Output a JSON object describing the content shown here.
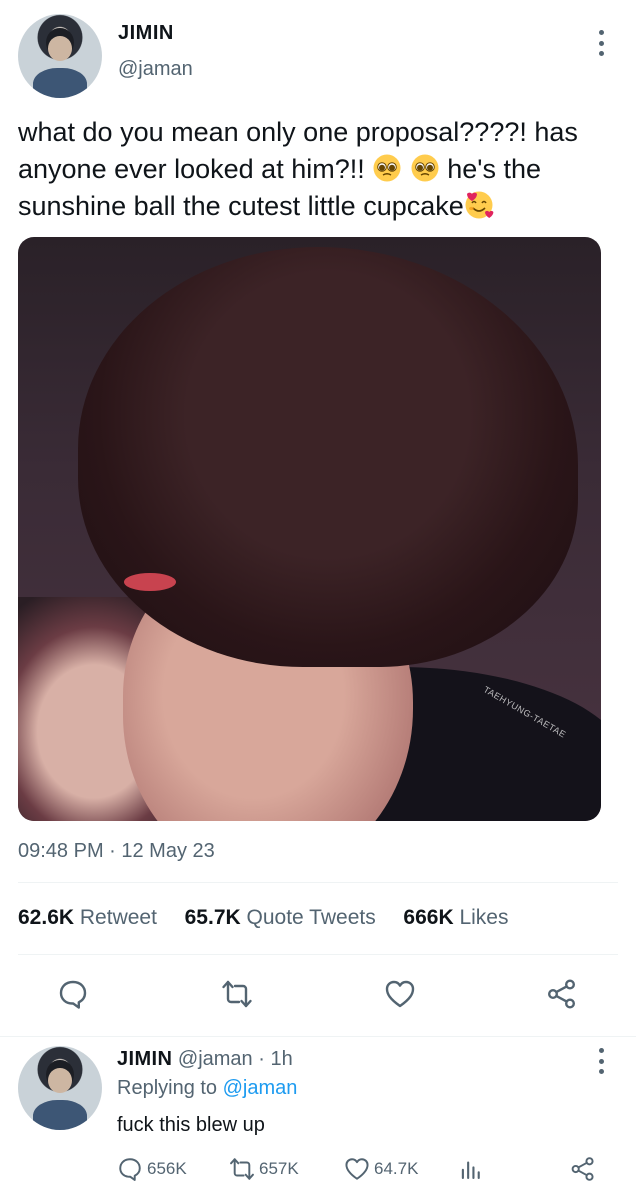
{
  "tweet": {
    "author_name": "JIMIN",
    "author_handle": "@jaman",
    "text_line1": "what do you mean only one proposal????! has",
    "text_line2_a": "anyone ever looked at him?!!",
    "text_line2_b": "he's the",
    "text_line3": "sunshine ball the cutest little cupcake",
    "photo_watermark": "TAEHYUNG-TAETAE",
    "timestamp": "09:48 PM · 12 May 23",
    "stats": {
      "retweets_count": "62.6K",
      "retweets_label": "Retweet",
      "quotes_count": "65.7K",
      "quotes_label": "Quote Tweets",
      "likes_count": "666K",
      "likes_label": "Likes"
    }
  },
  "reply": {
    "author_name": "JIMIN",
    "author_handle": "@jaman",
    "time": "· 1h",
    "replying_to_prefix": "Replying to",
    "replying_to_handle": "@jaman",
    "text": "fuck this blew up",
    "reply_count": "656K",
    "retweet_count": "657K",
    "like_count": "64.7K"
  },
  "icons": {
    "reply": "reply-bubble-icon",
    "retweet": "retweet-icon",
    "like": "heart-icon",
    "share": "share-icon",
    "views": "analytics-icon",
    "menu": "more-vertical-icon",
    "emoji_pleading": "pleading-face-emoji",
    "emoji_hearts": "smiling-face-with-hearts-emoji"
  },
  "colors": {
    "text": "#0f1419",
    "secondary": "#536471",
    "link": "#1d9bf0",
    "divider": "#eff3f4"
  }
}
